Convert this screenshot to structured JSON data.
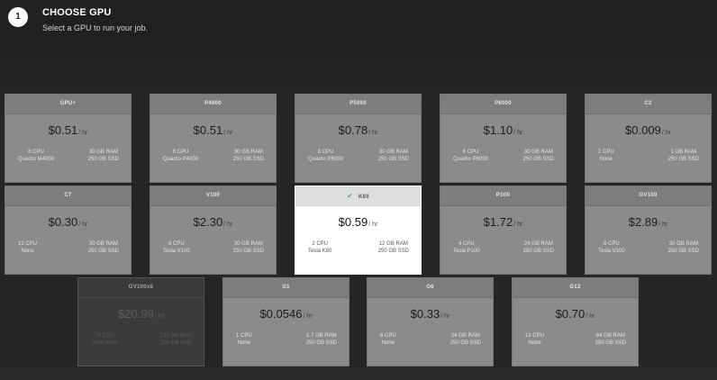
{
  "step": {
    "number": "1",
    "title": "CHOOSE GPU",
    "subtitle": "Select a GPU to run your job."
  },
  "cards": [
    {
      "name": "GPU+",
      "price": "$0.51",
      "unit": "/ hr",
      "cpu": "8 CPU",
      "gpu": "Quadro M4000",
      "ram": "30 GB RAM",
      "ssd": "250 GB SSD",
      "state": "normal"
    },
    {
      "name": "P4000",
      "price": "$0.51",
      "unit": "/ hr",
      "cpu": "8 CPU",
      "gpu": "Quadro P4000",
      "ram": "30 GB RAM",
      "ssd": "250 GB SSD",
      "state": "normal"
    },
    {
      "name": "P5000",
      "price": "$0.78",
      "unit": "/ hr",
      "cpu": "8 CPU",
      "gpu": "Quadro P5000",
      "ram": "30 GB RAM",
      "ssd": "250 GB SSD",
      "state": "normal"
    },
    {
      "name": "P6000",
      "price": "$1.10",
      "unit": "/ hr",
      "cpu": "8 CPU",
      "gpu": "Quadro P6000",
      "ram": "30 GB RAM",
      "ssd": "250 GB SSD",
      "state": "normal"
    },
    {
      "name": "C2",
      "price": "$0.009",
      "unit": "/ hr",
      "cpu": "1 CPU",
      "gpu": "None",
      "ram": "1 GB RAM",
      "ssd": "250 GB SSD",
      "state": "normal"
    },
    {
      "name": "C7",
      "price": "$0.30",
      "unit": "/ hr",
      "cpu": "12 CPU",
      "gpu": "None",
      "ram": "30 GB RAM",
      "ssd": "250 GB SSD",
      "state": "normal"
    },
    {
      "name": "V100",
      "price": "$2.30",
      "unit": "/ hr",
      "cpu": "8 CPU",
      "gpu": "Tesla V100",
      "ram": "30 GB RAM",
      "ssd": "250 GB SSD",
      "state": "normal"
    },
    {
      "name": "K80",
      "price": "$0.59",
      "unit": "/ hr",
      "cpu": "2 CPU",
      "gpu": "Tesla K80",
      "ram": "12 GB RAM",
      "ssd": "250 GB SSD",
      "state": "selected"
    },
    {
      "name": "P100",
      "price": "$1.72",
      "unit": "/ hr",
      "cpu": "4 CPU",
      "gpu": "Tesla P100",
      "ram": "24 GB RAM",
      "ssd": "250 GB SSD",
      "state": "normal"
    },
    {
      "name": "GV100",
      "price": "$2.89",
      "unit": "/ hr",
      "cpu": "8 CPU",
      "gpu": "Tesla V100",
      "ram": "30 GB RAM",
      "ssd": "250 GB SSD",
      "state": "normal"
    },
    {
      "name": "GV100x8",
      "price": "$20.99",
      "unit": "/ hr",
      "cpu": "79 CPU",
      "gpu": "Tesla V100",
      "ram": "138 GB RAM",
      "ssd": "250 GB SSD",
      "state": "disabled"
    },
    {
      "name": "G1",
      "price": "$0.0546",
      "unit": "/ hr",
      "cpu": "1 CPU",
      "gpu": "None",
      "ram": "1.7 GB RAM",
      "ssd": "250 GB SSD",
      "state": "normal"
    },
    {
      "name": "G6",
      "price": "$0.33",
      "unit": "/ hr",
      "cpu": "6 CPU",
      "gpu": "None",
      "ram": "24 GB RAM",
      "ssd": "250 GB SSD",
      "state": "normal"
    },
    {
      "name": "G12",
      "price": "$0.70",
      "unit": "/ hr",
      "cpu": "12 CPU",
      "gpu": "None",
      "ram": "64 GB RAM",
      "ssd": "250 GB SSD",
      "state": "normal"
    }
  ],
  "selected_check_icon": "check-icon",
  "colors": {
    "background": "#242526",
    "card": "#8b8b8b",
    "card_selected": "#ffffff",
    "check": "#41b477"
  }
}
